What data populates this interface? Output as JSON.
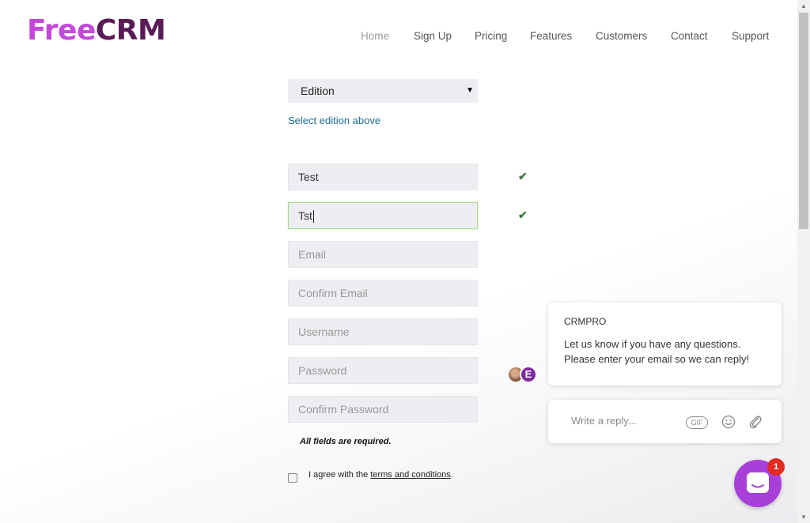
{
  "header": {
    "logo_part1": "Free",
    "logo_part2": "CRM",
    "nav": [
      "Home",
      "Sign Up",
      "Pricing",
      "Features",
      "Customers",
      "Contact",
      "Support"
    ]
  },
  "form": {
    "edition_select_value": "Edition",
    "edition_hint": "Select edition above",
    "first_name_value": "Test",
    "last_name_value": "Tst",
    "email_placeholder": "Email",
    "confirm_email_placeholder": "Confirm Email",
    "username_placeholder": "Username",
    "password_placeholder": "Password",
    "confirm_password_placeholder": "Confirm Password",
    "required_note": "All fields are required.",
    "agree_prefix": "I agree with the ",
    "agree_link": "terms and conditions",
    "agree_suffix": "."
  },
  "chat": {
    "avatar_letter": "E",
    "sender": "CRMPRO",
    "message_line1": "Let us know if you have any questions.",
    "message_line2": "Please enter your email so we can reply!",
    "reply_placeholder": "Write a reply...",
    "gif_label": "GIF",
    "unread_count": "1"
  },
  "colors": {
    "brand_light": "#c349d9",
    "brand_dark": "#5a1a57",
    "launcher": "#a83fd9",
    "badge": "#e22b25",
    "check": "#3d7a3d"
  }
}
